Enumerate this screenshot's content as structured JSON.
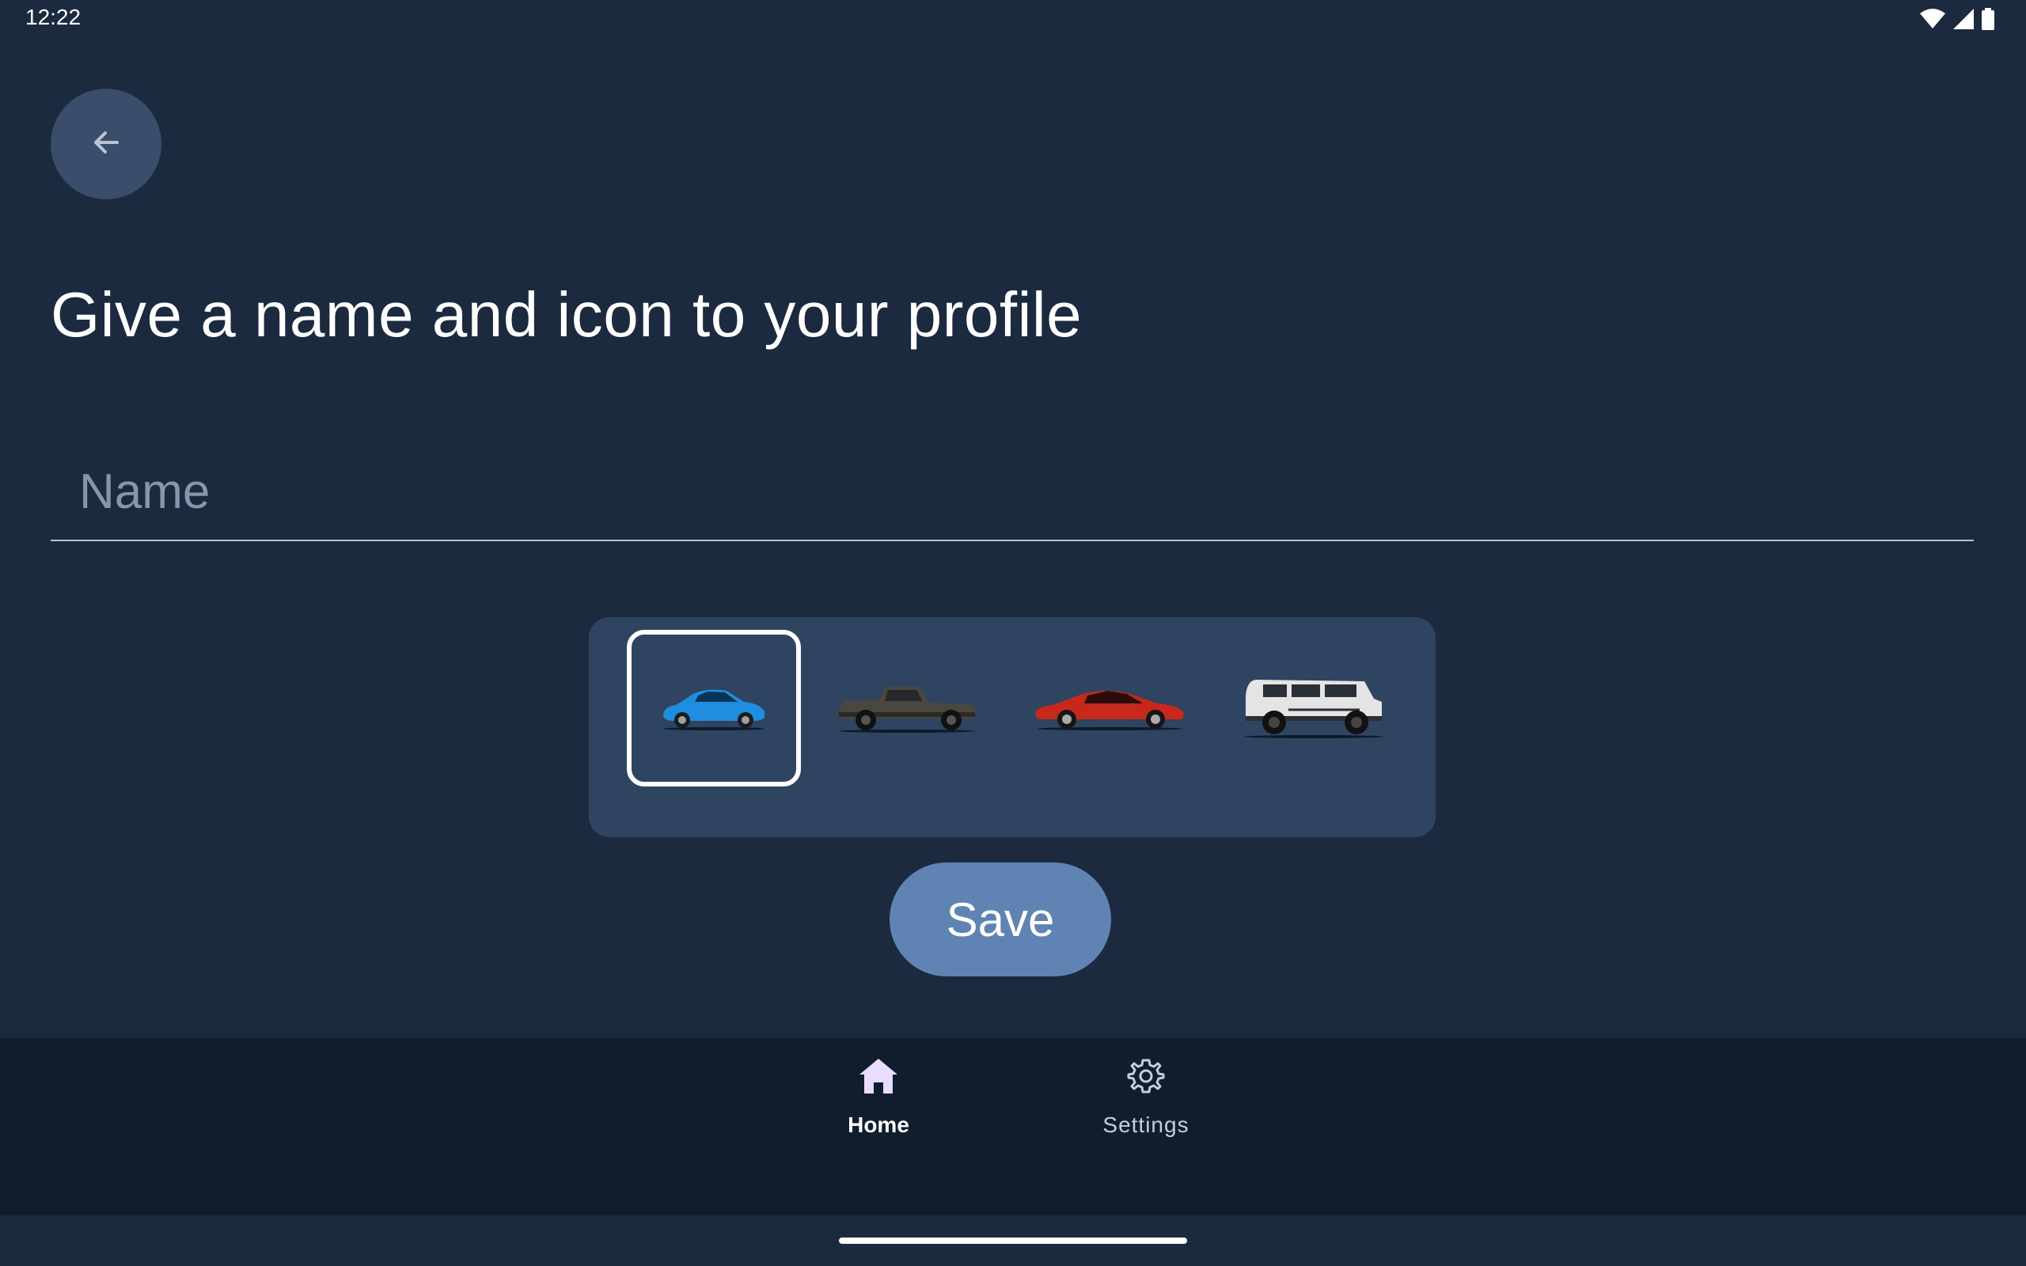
{
  "status_bar": {
    "time": "12:22",
    "icons": [
      "wifi-icon",
      "signal-icon",
      "battery-icon"
    ]
  },
  "header": {
    "back_icon": "arrow-left-icon",
    "title": "Give a name and icon to your profile"
  },
  "form": {
    "name_placeholder": "Name",
    "name_value": ""
  },
  "icon_picker": {
    "options": [
      {
        "name": "blue-suv-icon",
        "color": "#1f8ee0",
        "selected": true
      },
      {
        "name": "dark-pickup-truck-icon",
        "color": "#4a4640",
        "selected": false
      },
      {
        "name": "red-sports-car-icon",
        "color": "#c8281c",
        "selected": false
      },
      {
        "name": "white-offroad-suv-icon",
        "color": "#e4e4e4",
        "selected": false
      }
    ]
  },
  "actions": {
    "save_label": "Save"
  },
  "bottom_nav": {
    "items": [
      {
        "label": "Home",
        "icon": "home-icon",
        "active": true
      },
      {
        "label": "Settings",
        "icon": "gear-icon",
        "active": false
      }
    ]
  },
  "colors": {
    "background": "#1b2a3e",
    "card": "#2f4461",
    "accent": "#5f84b3",
    "nav_background": "#101d2c"
  }
}
